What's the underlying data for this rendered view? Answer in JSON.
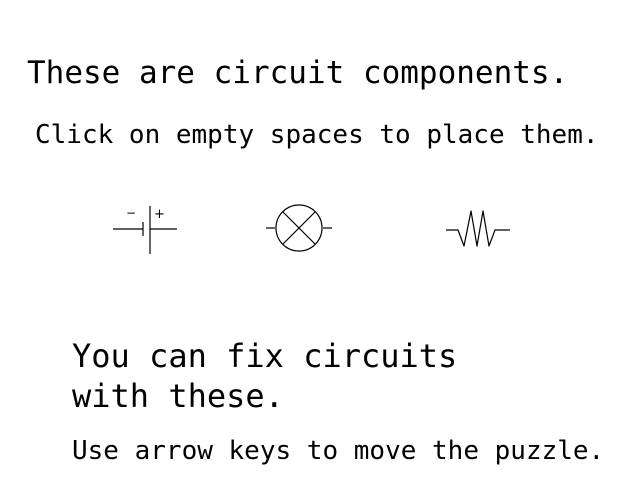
{
  "intro": {
    "heading": "These are circuit components.",
    "subheading": "Click on empty spaces to place them."
  },
  "components": [
    {
      "name": "battery",
      "icon": "battery-icon",
      "minus_label": "−",
      "plus_label": "+"
    },
    {
      "name": "light-bulb",
      "icon": "bulb-icon"
    },
    {
      "name": "resistor",
      "icon": "resistor-icon"
    }
  ],
  "outro": {
    "line1": "You can fix circuits",
    "line2": "with these.",
    "hint": "Use arrow keys to move the puzzle."
  },
  "colors": {
    "background": "#ffffff",
    "ink": "#000000"
  }
}
